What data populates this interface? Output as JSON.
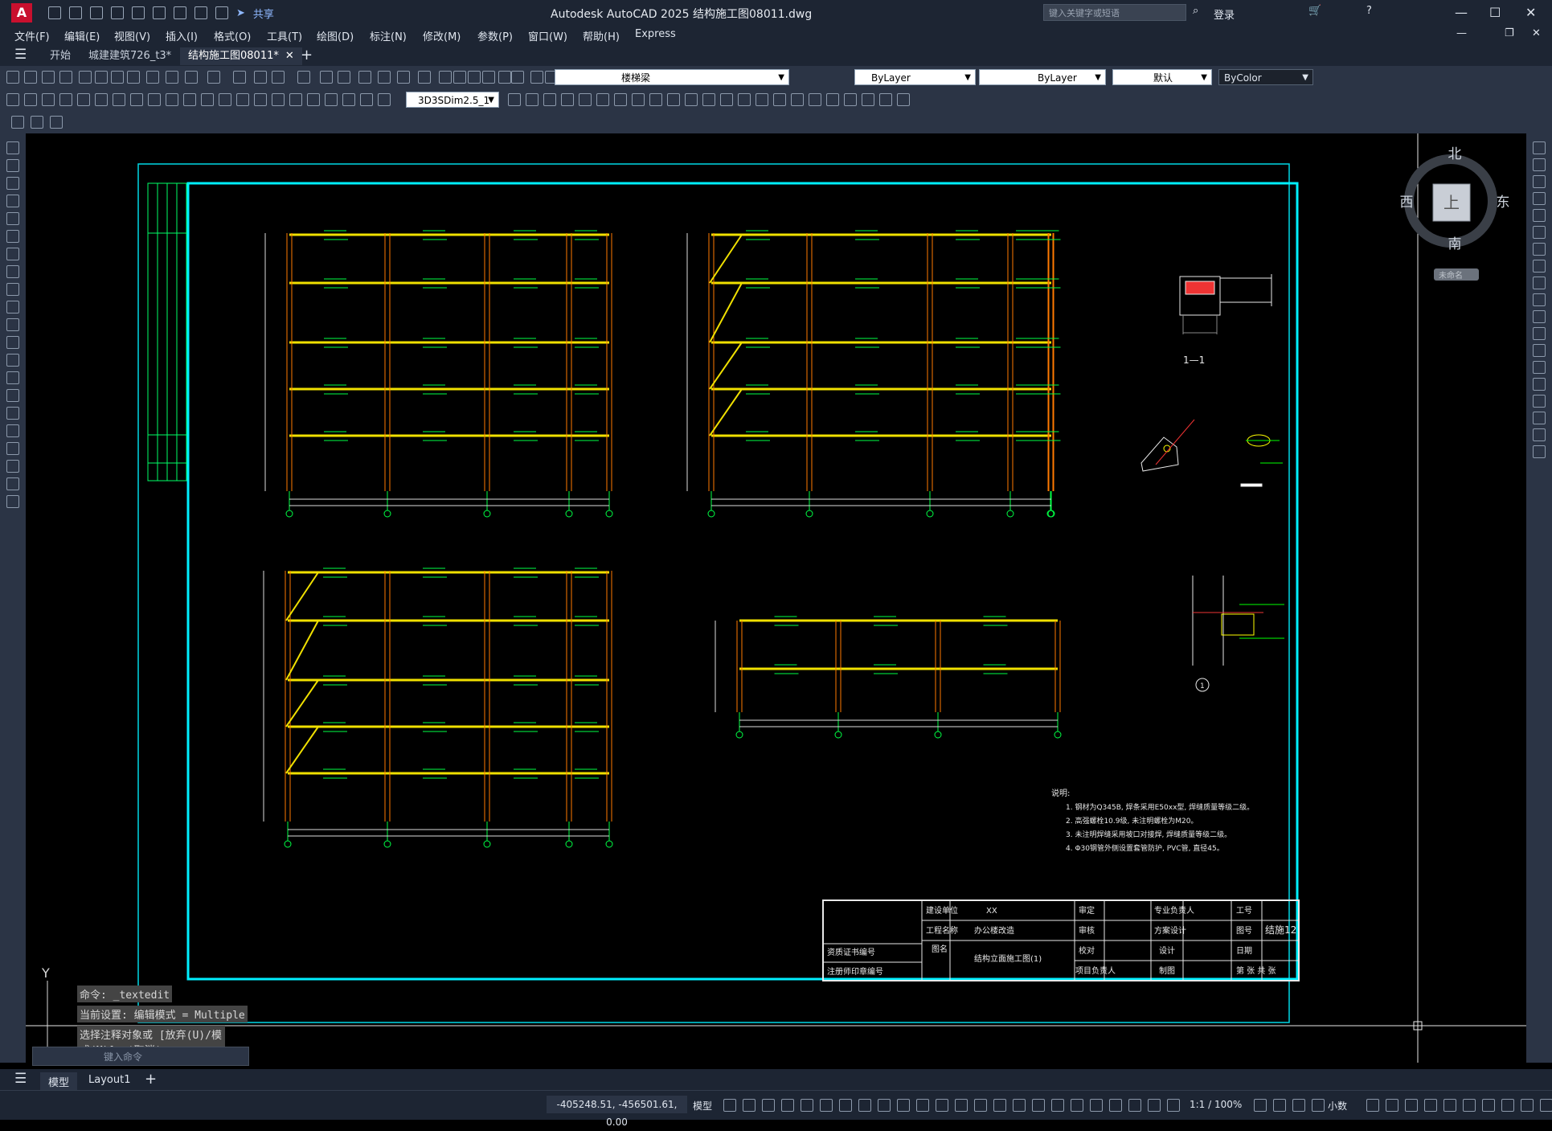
{
  "app": {
    "logo_letter": "A",
    "share_label": "共享",
    "window_title": "Autodesk AutoCAD 2025    结构施工图08011.dwg",
    "search_placeholder": "键入关键字或短语",
    "login_label": "登录"
  },
  "menu": [
    "文件(F)",
    "编辑(E)",
    "视图(V)",
    "插入(I)",
    "格式(O)",
    "工具(T)",
    "绘图(D)",
    "标注(N)",
    "修改(M)",
    "参数(P)",
    "窗口(W)",
    "帮助(H)",
    "Express"
  ],
  "tabs": [
    {
      "label": "开始",
      "active": false
    },
    {
      "label": "城建建筑726_t3*",
      "active": false
    },
    {
      "label": "结构施工图08011*",
      "active": true
    }
  ],
  "toolbar": {
    "layer_value": "楼梯梁",
    "color_value": "ByLayer",
    "linetype_value": "ByLayer",
    "lineweight_value": "默认",
    "plotstyle_value": "ByColor",
    "dimstyle_value": "3D3SDim2.5_1"
  },
  "viewcube": {
    "north": "北",
    "south": "南",
    "east": "东",
    "west": "西",
    "top": "上",
    "wcs": "未命名"
  },
  "drawing": {
    "section_label": "1—1",
    "axis_mark": "1",
    "notes_title": "说明:",
    "notes": [
      "1. 钢材为Q345B, 焊条采用E50xx型, 焊缝质量等级二级。",
      "2. 高强螺栓10.9级, 未注明螺栓为M20。",
      "3. 未注明焊缝采用坡口对接焊, 焊缝质量等级二级。",
      "4. Φ30钢管外侧设置套管防护, PVC管, 直径45。"
    ],
    "title_block": {
      "build_unit_label": "建设单位",
      "build_unit_value": "XX",
      "project_label": "工程名称",
      "project_value": "办公楼改造",
      "drawing_label": "图名",
      "drawing_value": "结构立面施工图(1)",
      "check_label": "审定",
      "audit_label": "审核",
      "proof_label": "校对",
      "lead_label": "专业负责人",
      "design_label": "方案设计",
      "design2_label": "设计",
      "draw_label": "制图",
      "job_label": "工号",
      "sheet_label": "图号",
      "sheet_value": "结施12",
      "date_label": "日期",
      "page_label": "第  张  共  张",
      "cert_label": "资质证书编号",
      "reg_label": "注册师印章编号",
      "person_label": "项目负责人"
    }
  },
  "command": {
    "history": [
      "命令: _textedit",
      "当前设置: 编辑模式 = Multiple",
      "选择注释对象或 [放弃(U)/模式(M)]: *取消*"
    ],
    "input_placeholder": "键入命令"
  },
  "layout_tabs": [
    "模型",
    "Layout1"
  ],
  "status": {
    "coords": "-405248.51, -456501.61, 0.00",
    "model_label": "模型",
    "scale": "1:1 / 100%",
    "units": "小数"
  }
}
